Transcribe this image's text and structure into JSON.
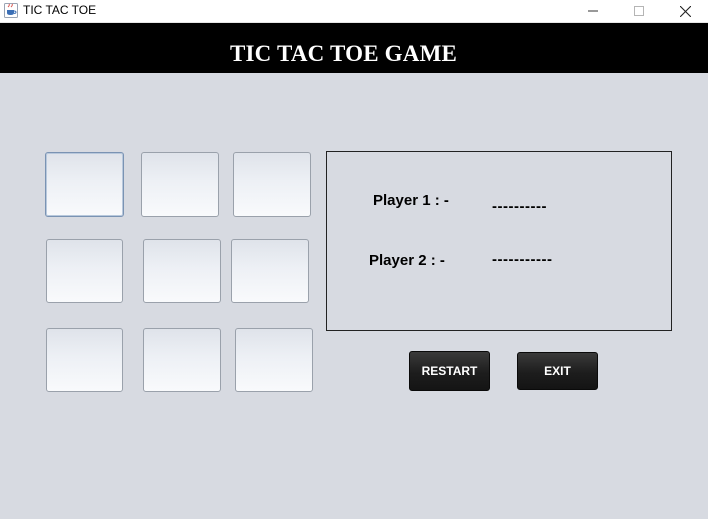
{
  "window": {
    "title": "TIC TAC TOE",
    "icon": "java-cup-icon"
  },
  "header": {
    "title": "TIC TAC TOE GAME",
    "background": "#000000",
    "color": "#ffffff"
  },
  "board": {
    "cells": [
      "",
      "",
      "",
      "",
      "",
      "",
      "",
      "",
      ""
    ]
  },
  "players": {
    "player1_label": "Player 1 : -",
    "player1_value": "----------",
    "player2_label": "Player 2 : -",
    "player2_value": "-----------"
  },
  "buttons": {
    "restart_label": "RESTART",
    "exit_label": "EXIT"
  },
  "colors": {
    "window_background": "#d7dae1",
    "button_background": "#1d1d1d",
    "button_text": "#ffffff"
  }
}
